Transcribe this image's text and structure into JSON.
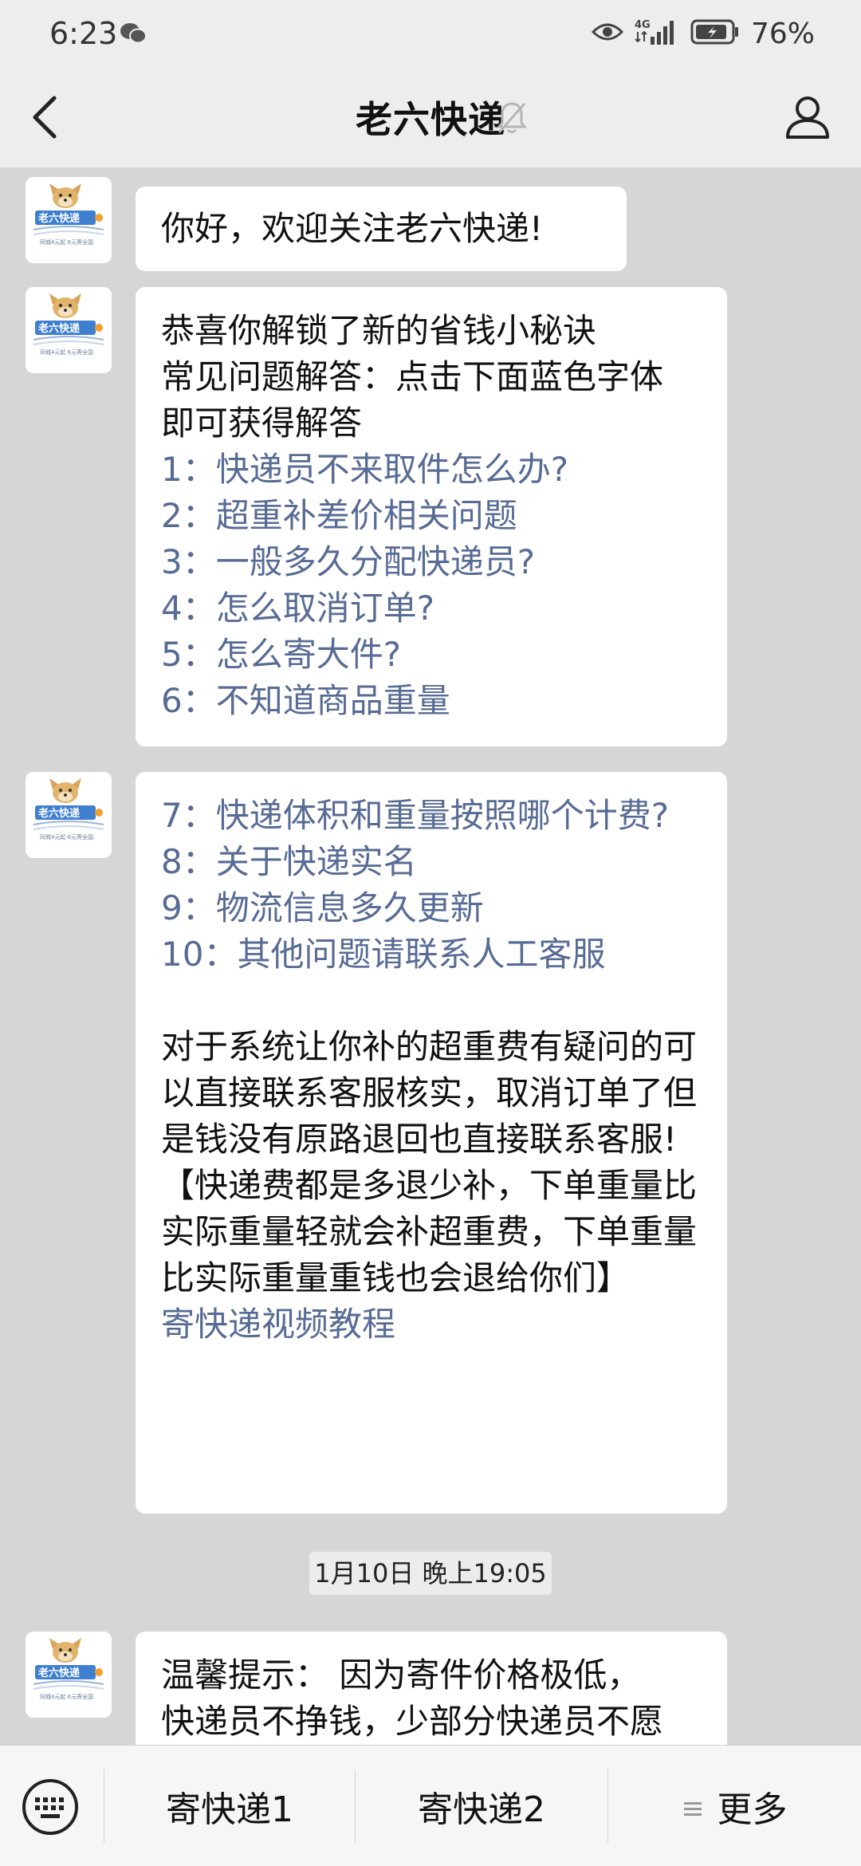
{
  "status_bar": {
    "time": "6:23",
    "network": "4G",
    "battery": "76%"
  },
  "header": {
    "title": "老六快递"
  },
  "avatar": {
    "brand": "老六快递",
    "tagline": "同城4元起 6元寄全国"
  },
  "messages": [
    {
      "lines": [
        "你好，欢迎关注老六快递!"
      ]
    },
    {
      "lines": [
        "恭喜你解锁了新的省钱小秘诀",
        "常见问题解答：点击下面蓝色字体",
        "即可获得解答"
      ],
      "links": [
        "1：快递员不来取件怎么办?",
        "2：超重补差价相关问题",
        "3：一般多久分配快递员?",
        "4：怎么取消订单?",
        "5：怎么寄大件?",
        "6：不知道商品重量"
      ]
    },
    {
      "links": [
        "7：快递体积和重量按照哪个计费?",
        "8：关于快递实名",
        "9：物流信息多久更新",
        "10：其他问题请联系人工客服"
      ],
      "paragraph": "对于系统让你补的超重费有疑问的可以直接联系客服核实，取消订单了但是钱没有原路退回也直接联系客服!",
      "note": "【快递费都是多退少补，下单重量比实际重量轻就会补超重费，下单重量比实际重量重钱也会退给你们】",
      "video_link": "寄快递视频教程"
    },
    {
      "timestamp": "1月10日 晚上19:05",
      "lines": [
        "温馨提示： 因为寄件价格极低，",
        "快递员不挣钱，少部分快递员不愿"
      ]
    }
  ],
  "bottom_menu": {
    "items": [
      "寄快递1",
      "寄快递2",
      "更多"
    ]
  },
  "colors": {
    "link": "#576b95",
    "bubble": "#ffffff",
    "chat_bg": "#d6d6d6",
    "bar_bg": "#ededed"
  }
}
